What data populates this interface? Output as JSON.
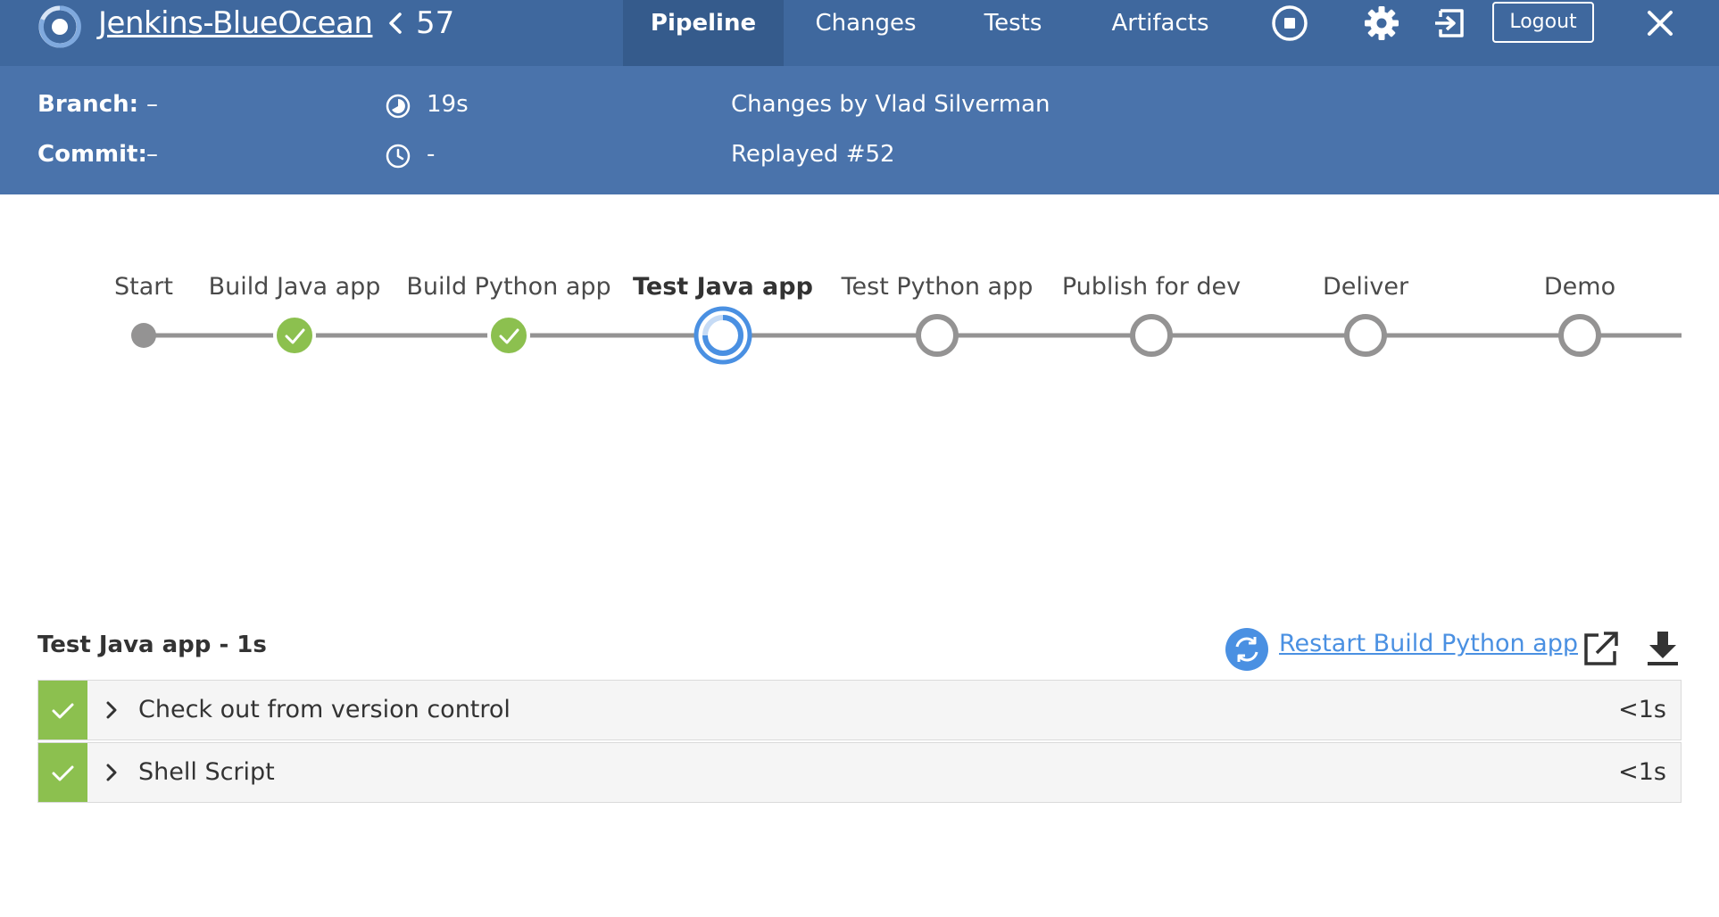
{
  "header": {
    "pipeline_name": "Jenkins-BlueOcean",
    "run_number": "57",
    "tabs": [
      {
        "label": "Pipeline",
        "active": true
      },
      {
        "label": "Changes",
        "active": false
      },
      {
        "label": "Tests",
        "active": false
      },
      {
        "label": "Artifacts",
        "active": false
      }
    ],
    "logout_label": "Logout",
    "icons": [
      "stop-icon",
      "gear-icon",
      "exit-icon",
      "close-icon"
    ]
  },
  "run_info": {
    "branch_label": "Branch:",
    "branch_value": "–",
    "commit_label": "Commit:",
    "commit_value": "–",
    "duration": "19s",
    "started": "-",
    "changes_by": "Changes by Vlad Silverman",
    "cause": "Replayed #52"
  },
  "pipeline_graph": {
    "stages": [
      {
        "label": "Start",
        "status": "start"
      },
      {
        "label": "Build Java app",
        "status": "success"
      },
      {
        "label": "Build Python app",
        "status": "success"
      },
      {
        "label": "Test Java app",
        "status": "running"
      },
      {
        "label": "Test Python app",
        "status": "not_built"
      },
      {
        "label": "Publish for dev",
        "status": "not_built"
      },
      {
        "label": "Deliver",
        "status": "not_built"
      },
      {
        "label": "Demo",
        "status": "not_built"
      }
    ]
  },
  "stage_detail": {
    "title": "Test Java app - 1s",
    "restart_label": "Restart Build Python app",
    "steps": [
      {
        "label": "Check out from version control",
        "duration": "<1s",
        "status": "success"
      },
      {
        "label": "Shell Script",
        "duration": "<1s",
        "status": "success"
      }
    ]
  },
  "colors": {
    "topbar": "#3f689e",
    "infobar": "#4a73ab",
    "success": "#8cc04f",
    "running": "#4a90e2",
    "not_built": "#949393",
    "link": "#4a90e2"
  }
}
